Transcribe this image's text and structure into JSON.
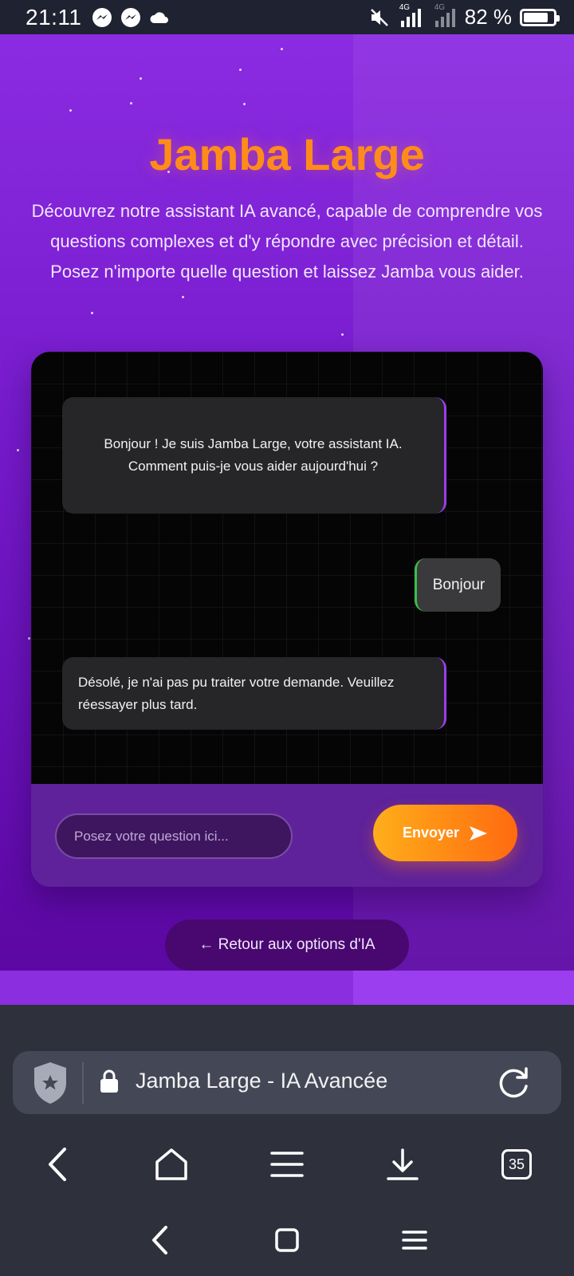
{
  "status_bar": {
    "time": "21:11",
    "signal_label_1": "4G",
    "signal_label_2": "4G",
    "battery_percent": "82 %",
    "battery_level": 0.82
  },
  "hero": {
    "title": "Jamba Large",
    "description": "Découvrez notre assistant IA avancé, capable de comprendre vos questions complexes et d'y répondre avec précision et détail. Posez n'importe quelle question et laissez Jamba vous aider."
  },
  "chat": {
    "messages": [
      {
        "role": "ai",
        "text": "Bonjour ! Je suis Jamba Large, votre assistant IA. Comment puis-je vous aider aujourd'hui ?"
      },
      {
        "role": "user",
        "text": "Bonjour"
      },
      {
        "role": "ai",
        "text": "Désolé, je n'ai pas pu traiter votre demande. Veuillez réessayer plus tard."
      }
    ],
    "input_placeholder": "Posez votre question ici...",
    "send_label": "Envoyer"
  },
  "back_link": "← Retour aux options d'IA",
  "browser": {
    "page_title": "Jamba Large - IA Avancée",
    "tab_count": "35"
  },
  "colors": {
    "accent_orange": "#ff8c1a",
    "background_purple": "#8b2be2",
    "ai_border": "#9b3df0",
    "user_border": "#3bbf4a"
  }
}
